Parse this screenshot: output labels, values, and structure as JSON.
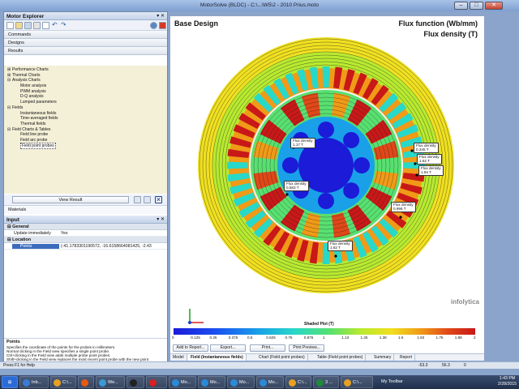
{
  "window": {
    "title": "MotorSolve (BLDC) - C:\\...\\W5\\2 - 2010 Prius.moto"
  },
  "explorer": {
    "title": "Motor Explorer",
    "nav": [
      "Commands",
      "Designs",
      "Results"
    ],
    "tree": [
      {
        "label": "Performance Charts",
        "level": 0,
        "expander": "+"
      },
      {
        "label": "Thermal Charts",
        "level": 0,
        "expander": "+"
      },
      {
        "label": "Analysis Charts",
        "level": 0,
        "expander": "-"
      },
      {
        "label": "Motor analysis",
        "level": 1,
        "expander": ""
      },
      {
        "label": "PWM analysis",
        "level": 1,
        "expander": ""
      },
      {
        "label": "D-Q analysis",
        "level": 1,
        "expander": ""
      },
      {
        "label": "Lumped parameters",
        "level": 1,
        "expander": ""
      },
      {
        "label": "Fields",
        "level": 0,
        "expander": "-"
      },
      {
        "label": "Instantaneous fields",
        "level": 1,
        "expander": ""
      },
      {
        "label": "Time-averaged fields",
        "level": 1,
        "expander": ""
      },
      {
        "label": "Thermal fields",
        "level": 1,
        "expander": ""
      },
      {
        "label": "Field Charts & Tables",
        "level": 0,
        "expander": "-"
      },
      {
        "label": "Field line probe",
        "level": 1,
        "expander": ""
      },
      {
        "label": "Field arc probe",
        "level": 1,
        "expander": ""
      },
      {
        "label": "Field point probes",
        "level": 1,
        "expander": "",
        "selected": true
      }
    ],
    "view_result": "View Result",
    "materials": "Materials"
  },
  "input": {
    "title": "Input",
    "general_label": "General",
    "update_label": "Update immediately",
    "update_value": "Yes",
    "location_label": "Location",
    "points_label": "Points",
    "points_value": "(-41.1783301190572, -16.6158664081425, -2.43"
  },
  "help": {
    "title": "Points",
    "lines": [
      "Specifies the coordinate of the points for the probes in millimeters.",
      "Normal clicking in the Field view specifies a single point probe.",
      "Ctrl+clicking in the Field view adds multiple probe point probes.",
      "Shift+clicking in the Field view replaces the most recent point probe with the new point",
      "probe."
    ]
  },
  "status": {
    "left": "Press F1 for Help",
    "x": "-53.3",
    "y": "56.3",
    "z": "0"
  },
  "view": {
    "title": "Base Design",
    "flux_function": "Flux function (Wb/mm)",
    "flux_density": "Flux density (T)",
    "probes": [
      {
        "label": "Flux density",
        "value": "1.17 T"
      },
      {
        "label": "Flux density",
        "value": "0.345 T"
      },
      {
        "label": "Flux density",
        "value": "1.52 T"
      },
      {
        "label": "Flux density",
        "value": "1.94 T"
      },
      {
        "label": "Flux density",
        "value": "0.583 T"
      },
      {
        "label": "Flux density",
        "value": "0.996 T"
      },
      {
        "label": "Flux density",
        "value": "1.82 T"
      }
    ],
    "logo": "infolytica",
    "shaded_plot": "Shaded Plot (T)",
    "colorbar_ticks": [
      "0",
      "0.125",
      "0.25",
      "0.375",
      "0.5",
      "0.625",
      "0.75",
      "0.875",
      "1",
      "1.13",
      "1.25",
      "1.38",
      "1.5",
      "1.63",
      "1.75",
      "1.88",
      "2"
    ],
    "colormap": [
      "#1b1bd8",
      "#1a4ff0",
      "#19a0e8",
      "#28d8c8",
      "#58e070",
      "#b8ea30",
      "#f0e020",
      "#f09a18",
      "#e04818",
      "#c81818"
    ],
    "buttons": [
      "Add to Report...",
      "Export...",
      "Print...",
      "Print Preview..."
    ],
    "tabs": [
      "Model",
      "Field (Instantaneous fields)",
      "Chart (Field point probes)",
      "Table (Field point probes)",
      "Summary",
      "Report"
    ]
  },
  "taskbar": {
    "items": [
      "Inb...",
      "C:\\...",
      "",
      "We...",
      "",
      "",
      "Mo...",
      "Mo...",
      "Mo...",
      "Mo...",
      "C:\\...",
      "3 ...",
      "C:\\..."
    ],
    "toolbar_label": "My Toolbar",
    "time": "1:43 PM",
    "date": "2/28/2015"
  }
}
